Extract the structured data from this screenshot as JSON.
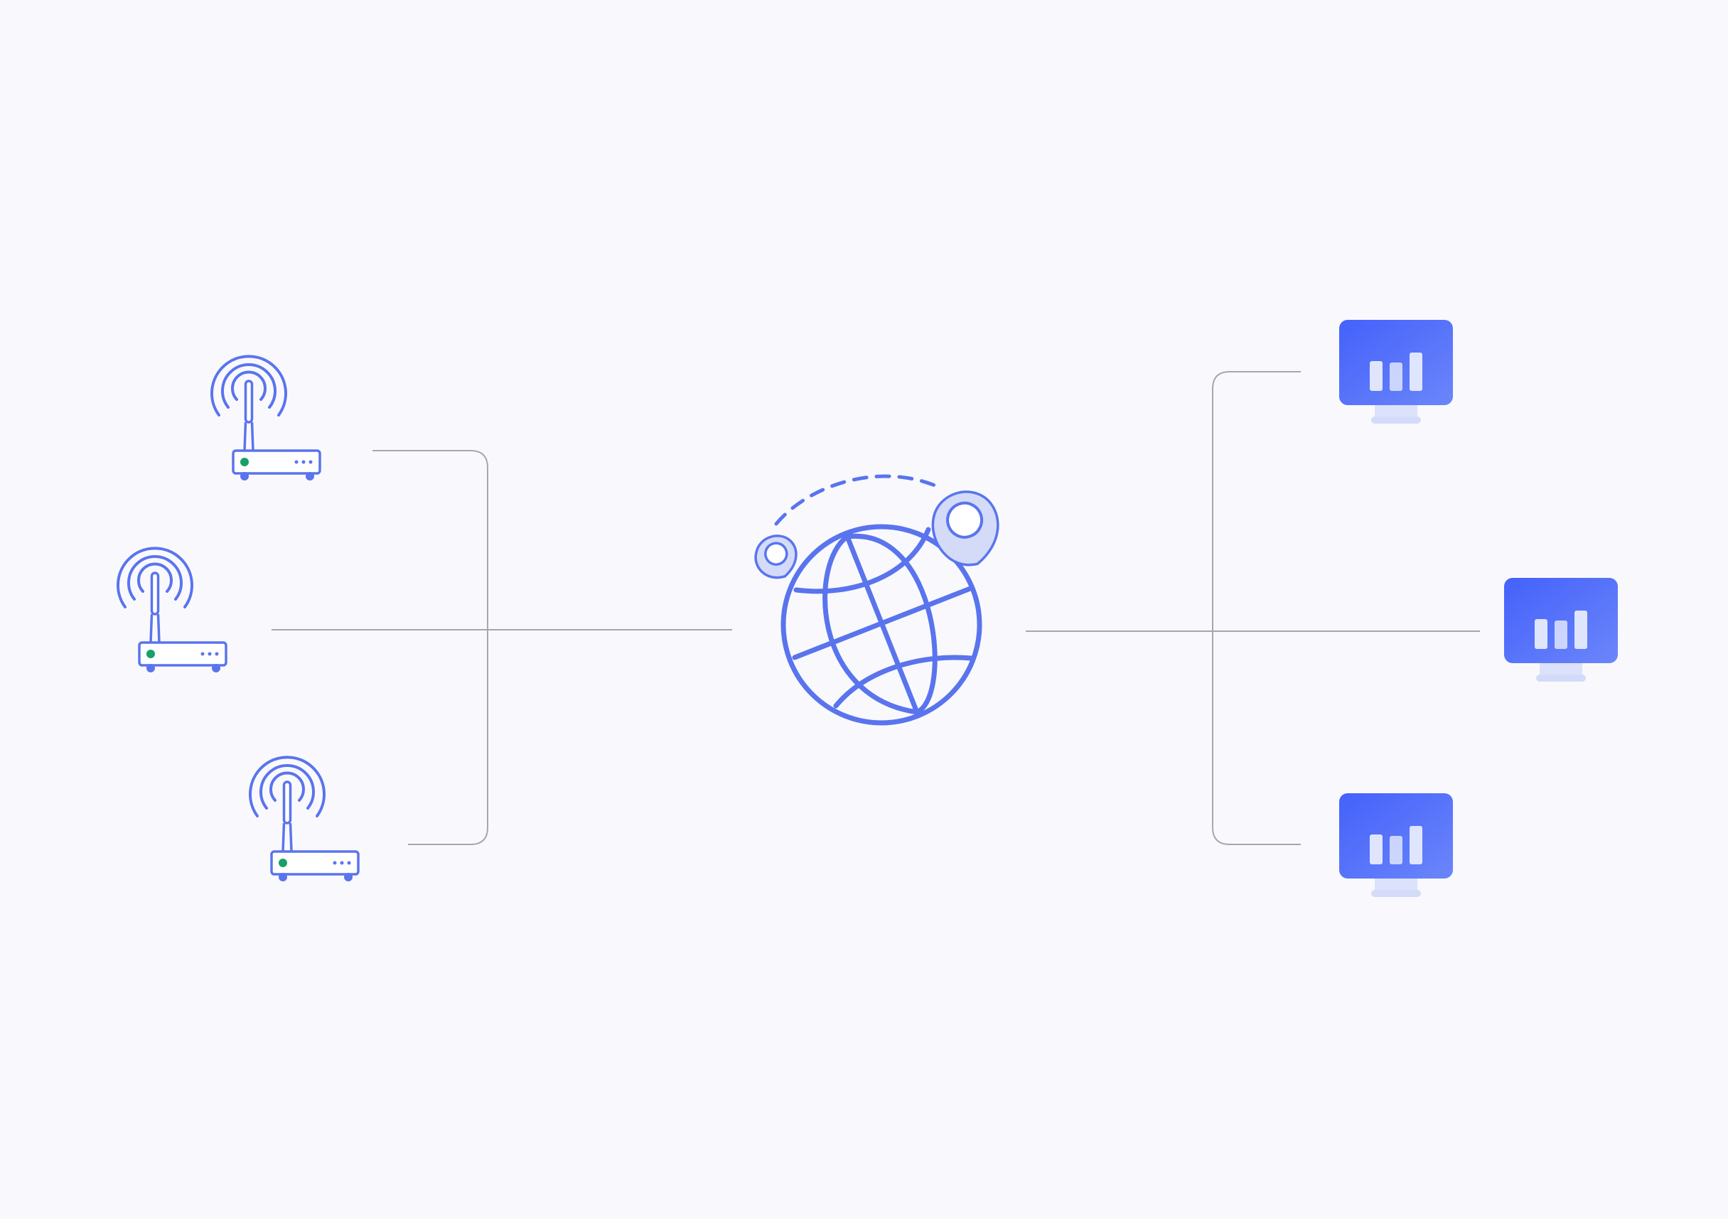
{
  "colors": {
    "background": "#f9f9fd",
    "connector_line": "#a6a6ad",
    "icon_stroke": "#5a74ee",
    "icon_fill_light": "#d3dbf8",
    "status_led": "#17a06a",
    "monitor_gradient_start": "#4461fb",
    "monitor_gradient_end": "#6b86fa",
    "monitor_stand": "#dce2fb",
    "bar_fill": "#dfe5fd"
  },
  "diagram": {
    "sources": [
      {
        "icon": "wireless-router-icon"
      },
      {
        "icon": "wireless-router-icon"
      },
      {
        "icon": "wireless-router-icon"
      }
    ],
    "hub": {
      "icon": "globe-icon",
      "markers": [
        "location-pin-icon",
        "location-pin-icon"
      ]
    },
    "destinations": [
      {
        "icon": "monitor-chart-icon"
      },
      {
        "icon": "monitor-chart-icon"
      },
      {
        "icon": "monitor-chart-icon"
      }
    ]
  }
}
